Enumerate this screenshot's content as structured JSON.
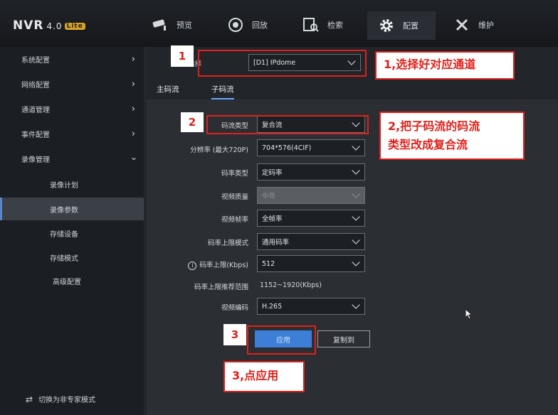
{
  "header": {
    "logo": "NVR",
    "version": "4.0",
    "badge": "Lite",
    "tabs": [
      {
        "label": "预览",
        "icon": "camera-icon"
      },
      {
        "label": "回放",
        "icon": "playback-icon"
      },
      {
        "label": "检索",
        "icon": "search-icon"
      },
      {
        "label": "配置",
        "icon": "gear-icon",
        "active": true
      },
      {
        "label": "维护",
        "icon": "tools-icon"
      }
    ]
  },
  "sidebar": {
    "items": [
      {
        "label": "系统配置",
        "expanded": false
      },
      {
        "label": "网络配置",
        "expanded": false
      },
      {
        "label": "通道管理",
        "expanded": false
      },
      {
        "label": "事件配置",
        "expanded": false
      },
      {
        "label": "录像管理",
        "expanded": true
      }
    ],
    "subitems": [
      "录像计划",
      "录像参数",
      "存储设备",
      "存储模式",
      "高级配置"
    ],
    "active_subitem": "录像参数",
    "switch_mode": "切换为非专家模式"
  },
  "main": {
    "channel_label": "通道选择",
    "channel_value": "[D1] IPdome",
    "tabs": [
      "主码流",
      "子码流"
    ],
    "active_tab": "子码流",
    "fields": {
      "stream_type": {
        "label": "码流类型",
        "value": "复合流"
      },
      "resolution": {
        "label": "分辨率 (最大720P)",
        "value": "704*576(4CIF)"
      },
      "bitrate_type": {
        "label": "码率类型",
        "value": "定码率"
      },
      "video_quality": {
        "label": "视频质量",
        "value": "中等"
      },
      "frame_rate": {
        "label": "视频帧率",
        "value": "全帧率"
      },
      "bitrate_limit_mode": {
        "label": "码率上限模式",
        "value": "通用码率"
      },
      "bitrate_limit": {
        "label": "码率上限(Kbps)",
        "value": "512"
      },
      "recommended_range": {
        "label": "码率上限推荐范围",
        "value": "1152~1920(Kbps)"
      },
      "video_codec": {
        "label": "视频编码",
        "value": "H.265"
      }
    },
    "apply_button": "应用",
    "copy_button": "复制到"
  },
  "annotations": {
    "numbers": [
      "1",
      "2",
      "3"
    ],
    "callouts": [
      "1,选择好对应通道",
      "2,把子码流的码流类型改成复合流",
      "3,点应用"
    ],
    "callout2_lines": [
      "2,把子码流的码流",
      "类型改成复合流"
    ]
  }
}
